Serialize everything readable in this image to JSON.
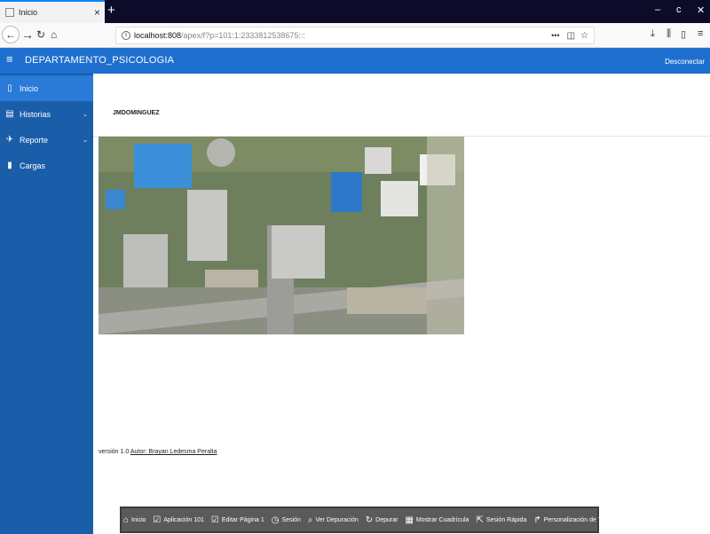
{
  "browser": {
    "tab_title": "Inicio",
    "tab_close": "×",
    "new_tab": "+",
    "win_min": "–",
    "win_restore": "ᴄ",
    "win_close": "✕",
    "url_host": "localhost:808",
    "url_path": "/apex/f?p=101:1:2333812538675:::",
    "url_more": "•••",
    "icons": [
      "back-icon",
      "forward-icon",
      "reload-icon",
      "home-icon",
      "download-icon",
      "library-icon",
      "sidebar-icon",
      "menu-icon"
    ]
  },
  "app": {
    "title": "DEPARTAMENTO_PSICOLOGIA",
    "logout": "Desconectar",
    "header_color": "#1f6fcf",
    "sidebar_color": "#1a5da9"
  },
  "sidebar": {
    "items": [
      {
        "label": "Inicio",
        "icon": "file-icon",
        "active": true
      },
      {
        "label": "Historias",
        "icon": "list-icon",
        "chevron": "⌄"
      },
      {
        "label": "Reporte",
        "icon": "plane-icon",
        "chevron": "⌄"
      },
      {
        "label": "Cargas",
        "icon": "document-icon"
      }
    ]
  },
  "main": {
    "user": "JMDOMINGUEZ",
    "version_prefix": "versión 1.0",
    "version_link": "Autor: Brayan Ledesma Peralta"
  },
  "debug_bar": {
    "items": [
      {
        "label": "Inicio",
        "icon": "home-icon"
      },
      {
        "label": "Aplicación 101",
        "icon": "edit-icon"
      },
      {
        "label": "Editar Página 1",
        "icon": "edit-page-icon"
      },
      {
        "label": "Sesión",
        "icon": "clock-icon"
      },
      {
        "label": "Ver Depuración",
        "icon": "bug-icon"
      },
      {
        "label": "Depurar",
        "icon": "refresh-icon"
      },
      {
        "label": "Mostrar Cuadrícula",
        "icon": "grid-icon"
      },
      {
        "label": "Sesión Rápida",
        "icon": "quick-icon"
      },
      {
        "label": "Personalización de Temas",
        "icon": "theme-icon"
      },
      {
        "label": "",
        "icon": "settings-icon"
      }
    ]
  }
}
